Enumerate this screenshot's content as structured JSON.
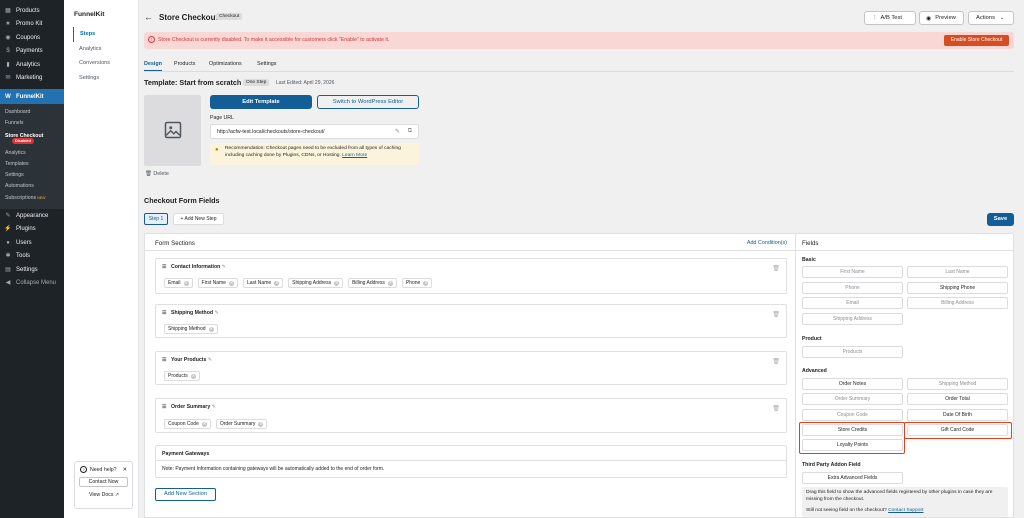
{
  "wp_menu": {
    "top_items": [
      {
        "label": "Products",
        "icon": "products-icon"
      },
      {
        "label": "Promo Kit",
        "icon": "promo-icon"
      },
      {
        "label": "Coupons",
        "icon": "coupons-icon"
      },
      {
        "label": "Payments",
        "icon": "payments-icon"
      },
      {
        "label": "Analytics",
        "icon": "analytics-icon"
      },
      {
        "label": "Marketing",
        "icon": "marketing-icon"
      }
    ],
    "funnelkit_label": "FunnelKit",
    "sub_items": [
      "Dashboard",
      "Funnels",
      "Store Checkout",
      "Analytics",
      "Templates",
      "Settings",
      "Automations",
      "Subscriptions"
    ],
    "disabled_badge": "Disabled",
    "new_tag": "NEW",
    "bottom_items": [
      "Appearance",
      "Plugins",
      "Users",
      "Tools",
      "Settings",
      "Collapse Menu"
    ]
  },
  "fk_sidebar": {
    "brand": "FunnelKit",
    "nav": [
      "Steps",
      "Analytics",
      "Conversions",
      "Settings"
    ],
    "help": {
      "title": "Need help?",
      "contact": "Contact Now",
      "docs": "View Docs"
    }
  },
  "header": {
    "title": "Store Checkout",
    "tag": "Checkout",
    "ab_test": "A/B Test",
    "preview": "Preview",
    "actions": "Actions"
  },
  "alert": {
    "message": "Store Checkout is currently disabled. To make it accessible for customers click \"Enable\" to activate it.",
    "button": "Enable Store Checkout"
  },
  "tabs": [
    "Design",
    "Products",
    "Optimizations",
    "Settings"
  ],
  "template": {
    "title": "Template: Start from scratch",
    "step_badge": "One Step",
    "last_edited": "Last Edited: April 29, 2026",
    "edit_btn": "Edit Template",
    "wp_btn": "Switch to WordPress Editor",
    "page_url_label": "Page URL",
    "page_url": "http://acfw-test.local/checkouts/store-checkout/",
    "recommendation": "Recommendation: Checkout pages need to be excluded from all types of caching including caching done by Plugins, CDNs, or Hosting.",
    "learn_more": "Learn More",
    "delete": "Delete"
  },
  "form_fields": {
    "title": "Checkout Form Fields",
    "step1": "Step 1",
    "add_step": "+ Add New Step",
    "save": "Save",
    "sections_title": "Form Sections",
    "add_condition": "Add Condition(s)",
    "sections": [
      {
        "name": "Contact Information",
        "chips": [
          "Email",
          "First Name",
          "Last Name",
          "Shipping Address",
          "Billing Address",
          "Phone"
        ]
      },
      {
        "name": "Shipping Method",
        "chips": [
          "Shipping Method"
        ]
      },
      {
        "name": "Your Products",
        "chips": [
          "Products"
        ]
      },
      {
        "name": "Order Summary",
        "chips": [
          "Coupon Code",
          "Order Summary"
        ]
      }
    ],
    "payment": {
      "title": "Payment Gateways",
      "note": "Note: Payment Information containing gateways will be automatically added to the end of order form."
    },
    "add_section": "Add New Section"
  },
  "fields_panel": {
    "title": "Fields",
    "basic_label": "Basic",
    "basic": [
      "First Name",
      "Last Name",
      "Phone",
      "Shipping Phone",
      "Email",
      "Billing Address",
      "Shipping Address"
    ],
    "product_label": "Product",
    "product": [
      "Products"
    ],
    "advanced_label": "Advanced",
    "advanced": [
      "Order Notes",
      "Shipping Method",
      "Order Summary",
      "Order Total",
      "Coupon Code",
      "Date Of Birth",
      "Store Credits",
      "Gift Card Code",
      "Loyalty Points"
    ],
    "third_party_label": "Third Party Addon Field",
    "extra": "Extra Advanced Fields",
    "info": "Drag this field to show the advanced fields registered by other plugins in case they are missing from the checkout.",
    "still_not": "Still not seeing field on the checkout?",
    "contact_support": "Contact Support"
  },
  "colors": {
    "accent": "#135e96",
    "alert_bg": "#f8d7d4",
    "alert_text": "#d63638",
    "enable_btn": "#d54e21",
    "highlight": "#e2401c"
  }
}
